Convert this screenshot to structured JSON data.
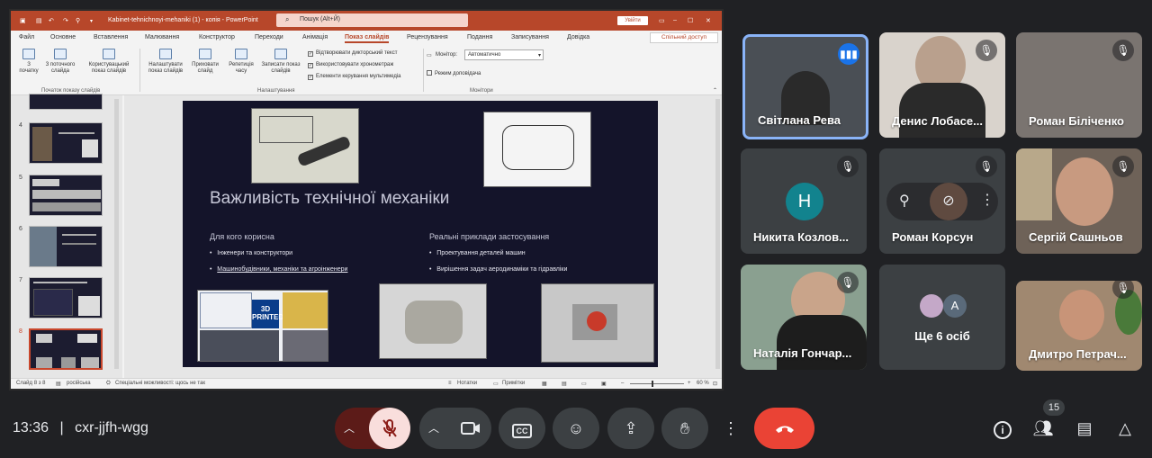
{
  "ppt": {
    "window_title": "Kabinet-tehnichnoyi-mehaniki (1) - копія  -  PowerPoint",
    "search_placeholder": "Пошук (Alt+Й)",
    "signin": "Увійти",
    "share_label": "Спільний доступ",
    "menu": [
      "Файл",
      "Основне",
      "Вставлення",
      "Малювання",
      "Конструктор",
      "Переходи",
      "Анімація",
      "Показ слайдів",
      "Рецензування",
      "Подання",
      "Записування",
      "Довідка"
    ],
    "ribbon": {
      "from_start": "З\nпочатку",
      "from_current": "З поточного\nслайда",
      "custom_show": "Користувацький\nпоказ слайдів",
      "group1": "Початок показу слайдів",
      "setup": "Налаштувати\nпоказ слайдів",
      "hide": "Приховати\nслайд",
      "rehearse": "Репетиція\nчасу",
      "record": "Записати показ\nслайдів",
      "chk_narration": "Відтворювати дикторський текст",
      "chk_timings": "Використовувати хронометраж",
      "chk_media": "Елементи керування мультимедіа",
      "group2": "Налаштування",
      "monitor_label": "Монітор:",
      "monitor_value": "Автоматично",
      "presenter_view": "Режим доповідача",
      "group3": "Монітори"
    },
    "thumb_numbers": [
      "4",
      "5",
      "6",
      "7",
      "8"
    ],
    "slide": {
      "title": "Важливість технічної механіки",
      "left_heading": "Для кого корисна",
      "left_b1": "Інженери та конструктори",
      "left_b2": "Машинобудівники, механіки та агроінженери",
      "right_heading": "Реальні приклади застосування",
      "right_b1": "Проектування деталей машин",
      "right_b2": "Вирішення задач аеродинаміки та гідравліки",
      "printed_badge": "3D PRINTED"
    },
    "status": {
      "slide_of": "Слайд 8 з 8",
      "language": "російська",
      "accessibility": "Спеціальні можливості: щось не так",
      "notes": "Нотатки",
      "comments": "Примітки",
      "zoom": "60 %"
    }
  },
  "participants": [
    {
      "name": "Світлана Рева"
    },
    {
      "name": "Денис Лобасе..."
    },
    {
      "name": "Роман Біліченко"
    },
    {
      "name": "Никита Козлов...",
      "initial": "Н"
    },
    {
      "name": "Роман Корсун"
    },
    {
      "name": "Сергій Сашньов"
    },
    {
      "name": "Наталія Гончар..."
    },
    {
      "name": "Ще 6 осіб",
      "initial": "А"
    },
    {
      "name": "Дмитро Петрач..."
    }
  ],
  "bottom": {
    "time": "13:36",
    "separator": "|",
    "meeting_code": "cxr-jjfh-wgg",
    "people_count": "15"
  },
  "colors": {
    "accent": "#b7472a",
    "end_call": "#ea4335",
    "mic_off": "#f9dedc",
    "speaking": "#8ab4f8"
  }
}
